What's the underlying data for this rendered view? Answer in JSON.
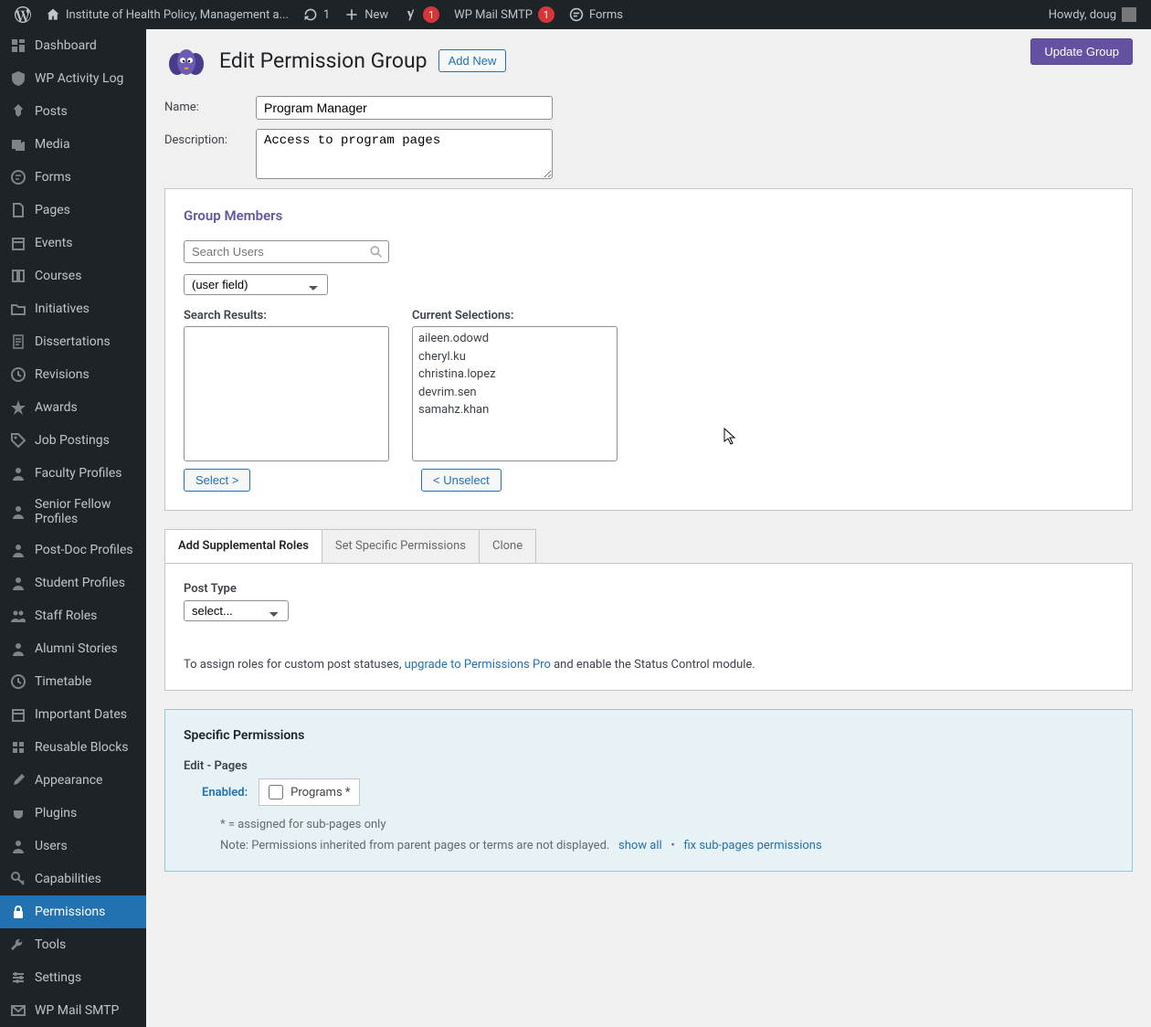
{
  "adminbar": {
    "site_name": "Institute of Health Policy, Management a...",
    "updates": "1",
    "new_label": "New",
    "yoast_badge": "1",
    "wp_mail_smtp": "WP Mail SMTP",
    "wp_mail_smtp_badge": "1",
    "forms": "Forms",
    "howdy": "Howdy, doug"
  },
  "sidebar": {
    "items": [
      {
        "label": "Dashboard",
        "icon": "dashboard",
        "current": false
      },
      {
        "label": "WP Activity Log",
        "icon": "shield",
        "current": false
      },
      {
        "label": "Posts",
        "icon": "pin",
        "current": false
      },
      {
        "label": "Media",
        "icon": "media",
        "current": false
      },
      {
        "label": "Forms",
        "icon": "forms",
        "current": false
      },
      {
        "label": "Pages",
        "icon": "page",
        "current": false
      },
      {
        "label": "Events",
        "icon": "calendar",
        "current": false
      },
      {
        "label": "Courses",
        "icon": "book",
        "current": false
      },
      {
        "label": "Initiatives",
        "icon": "folder",
        "current": false
      },
      {
        "label": "Dissertations",
        "icon": "doc",
        "current": false
      },
      {
        "label": "Revisions",
        "icon": "clock",
        "current": false
      },
      {
        "label": "Awards",
        "icon": "star",
        "current": false
      },
      {
        "label": "Job Postings",
        "icon": "tag",
        "current": false
      },
      {
        "label": "Faculty Profiles",
        "icon": "user",
        "current": false
      },
      {
        "label": "Senior Fellow Profiles",
        "icon": "user",
        "current": false
      },
      {
        "label": "Post-Doc Profiles",
        "icon": "user",
        "current": false
      },
      {
        "label": "Student Profiles",
        "icon": "user",
        "current": false
      },
      {
        "label": "Staff Roles",
        "icon": "users",
        "current": false
      },
      {
        "label": "Alumni Stories",
        "icon": "user",
        "current": false
      },
      {
        "label": "Timetable",
        "icon": "clock",
        "current": false
      },
      {
        "label": "Important Dates",
        "icon": "calendar",
        "current": false
      },
      {
        "label": "Reusable Blocks",
        "icon": "blocks",
        "current": false
      },
      {
        "label": "Appearance",
        "icon": "brush",
        "current": false
      },
      {
        "label": "Plugins",
        "icon": "plug",
        "current": false
      },
      {
        "label": "Users",
        "icon": "user",
        "current": false
      },
      {
        "label": "Capabilities",
        "icon": "key",
        "current": false
      },
      {
        "label": "Permissions",
        "icon": "lock",
        "current": true
      },
      {
        "label": "Tools",
        "icon": "wrench",
        "current": false
      },
      {
        "label": "Settings",
        "icon": "sliders",
        "current": false
      },
      {
        "label": "WP Mail SMTP",
        "icon": "mail",
        "current": false
      }
    ]
  },
  "page": {
    "title": "Edit Permission Group",
    "add_new": "Add New",
    "update_btn": "Update Group"
  },
  "form": {
    "name_label": "Name:",
    "name_value": "Program Manager",
    "desc_label": "Description:",
    "desc_value": "Access to program pages"
  },
  "members": {
    "title": "Group Members",
    "search_placeholder": "Search Users",
    "user_field": "(user field)",
    "search_results_label": "Search Results:",
    "current_selections_label": "Current Selections:",
    "selections": [
      "aileen.odowd",
      "cheryl.ku",
      "christina.lopez",
      "devrim.sen",
      "samahz.khan"
    ],
    "select_btn": "Select >",
    "unselect_btn": "< Unselect"
  },
  "tabs": {
    "items": [
      "Add Supplemental Roles",
      "Set Specific Permissions",
      "Clone"
    ],
    "active": 0
  },
  "supplemental": {
    "post_type_label": "Post Type",
    "post_type_value": "select...",
    "note_prefix": "To assign roles for custom post statuses, ",
    "note_link": "upgrade to Permissions Pro",
    "note_suffix": " and enable the Status Control module."
  },
  "specific": {
    "title": "Specific Permissions",
    "edit_pages": "Edit - Pages",
    "enabled": "Enabled:",
    "programs": "Programs *",
    "foot1": "* = assigned for sub-pages only",
    "foot2": "Note: Permissions inherited from parent pages or terms are not displayed.",
    "show_all": "show all",
    "bullet": "•",
    "fix_link": "fix sub-pages permissions"
  }
}
